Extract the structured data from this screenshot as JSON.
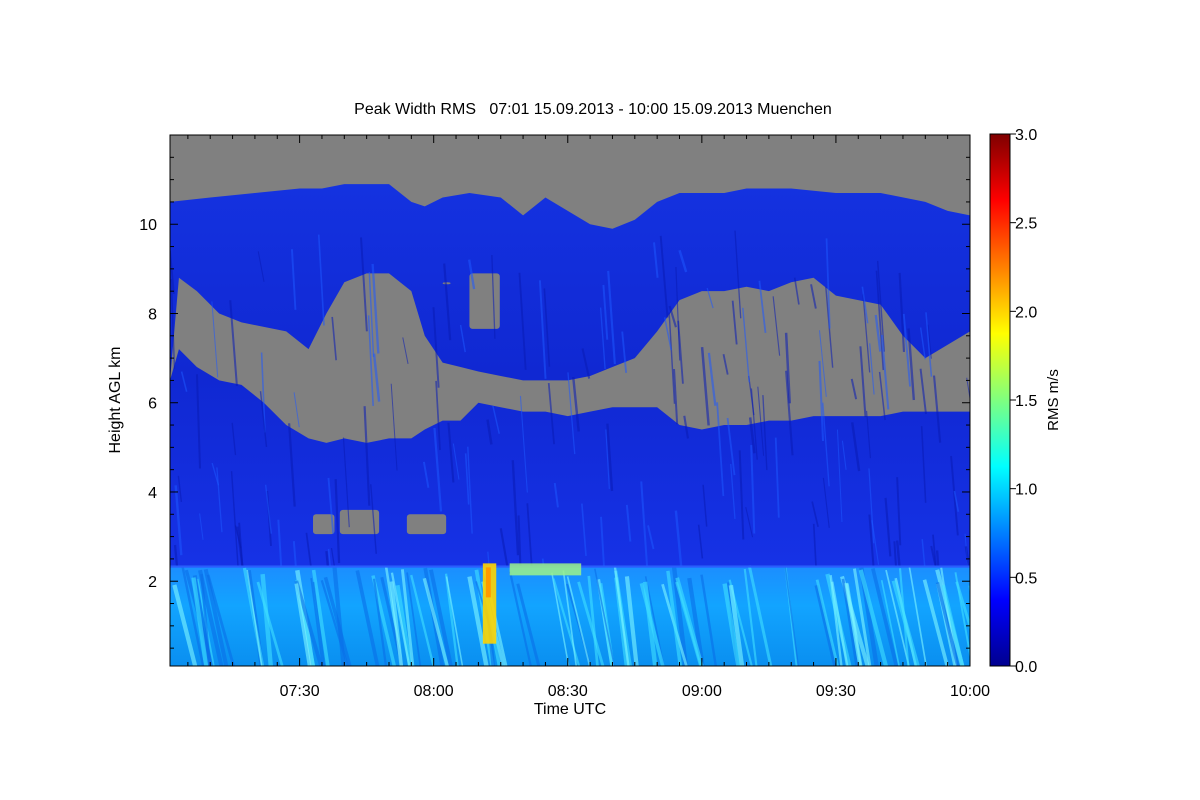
{
  "chart_data": {
    "type": "heatmap",
    "title": "Peak Width RMS   07:01 15.09.2013 - 10:00 15.09.2013 Muenchen",
    "xlabel": "Time UTC",
    "ylabel": "Height AGL km",
    "colorbar_label": "RMS m/s",
    "x_range_minutes": [
      421,
      600
    ],
    "y_range_km": [
      0.1,
      12.0
    ],
    "x_ticks": [
      {
        "min": 450,
        "label": "07:30"
      },
      {
        "min": 480,
        "label": "08:00"
      },
      {
        "min": 510,
        "label": "08:30"
      },
      {
        "min": 540,
        "label": "09:00"
      },
      {
        "min": 570,
        "label": "09:30"
      },
      {
        "min": 600,
        "label": "10:00"
      }
    ],
    "y_ticks": [
      {
        "v": 2,
        "label": "2"
      },
      {
        "v": 4,
        "label": "4"
      },
      {
        "v": 6,
        "label": "6"
      },
      {
        "v": 8,
        "label": "8"
      },
      {
        "v": 10,
        "label": "10"
      }
    ],
    "colorbar_range": [
      0.0,
      3.0
    ],
    "colorbar_ticks": [
      {
        "v": 0.0,
        "label": "0.0"
      },
      {
        "v": 0.5,
        "label": "0.5"
      },
      {
        "v": 1.0,
        "label": "1.0"
      },
      {
        "v": 1.5,
        "label": "1.5"
      },
      {
        "v": 2.0,
        "label": "2.0"
      },
      {
        "v": 2.5,
        "label": "2.5"
      },
      {
        "v": 3.0,
        "label": "3.0"
      }
    ],
    "colormap": "jet",
    "no_data_color": "#808080",
    "boundary_layer_top_km": 2.35,
    "cloud_top_km": [
      {
        "min": 421,
        "km": 10.5
      },
      {
        "min": 430,
        "km": 10.6
      },
      {
        "min": 440,
        "km": 10.7
      },
      {
        "min": 450,
        "km": 10.8
      },
      {
        "min": 455,
        "km": 10.8
      },
      {
        "min": 460,
        "km": 10.9
      },
      {
        "min": 470,
        "km": 10.9
      },
      {
        "min": 475,
        "km": 10.5
      },
      {
        "min": 478,
        "km": 10.4
      },
      {
        "min": 482,
        "km": 10.6
      },
      {
        "min": 488,
        "km": 10.7
      },
      {
        "min": 495,
        "km": 10.6
      },
      {
        "min": 500,
        "km": 10.2
      },
      {
        "min": 505,
        "km": 10.6
      },
      {
        "min": 510,
        "km": 10.3
      },
      {
        "min": 515,
        "km": 10.0
      },
      {
        "min": 520,
        "km": 9.9
      },
      {
        "min": 525,
        "km": 10.1
      },
      {
        "min": 530,
        "km": 10.5
      },
      {
        "min": 535,
        "km": 10.7
      },
      {
        "min": 540,
        "km": 10.7
      },
      {
        "min": 545,
        "km": 10.7
      },
      {
        "min": 550,
        "km": 10.8
      },
      {
        "min": 555,
        "km": 10.8
      },
      {
        "min": 560,
        "km": 10.8
      },
      {
        "min": 570,
        "km": 10.7
      },
      {
        "min": 580,
        "km": 10.7
      },
      {
        "min": 590,
        "km": 10.5
      },
      {
        "min": 595,
        "km": 10.3
      },
      {
        "min": 600,
        "km": 10.2
      }
    ],
    "clear_gap": [
      {
        "min": 421,
        "top": 6.5,
        "bot": 6.5
      },
      {
        "min": 423,
        "top": 8.8,
        "bot": 7.2
      },
      {
        "min": 427,
        "top": 8.5,
        "bot": 6.8
      },
      {
        "min": 432,
        "top": 8.0,
        "bot": 6.5
      },
      {
        "min": 437,
        "top": 7.8,
        "bot": 6.4
      },
      {
        "min": 442,
        "top": 7.7,
        "bot": 6.0
      },
      {
        "min": 447,
        "top": 7.6,
        "bot": 5.5
      },
      {
        "min": 452,
        "top": 7.2,
        "bot": 5.2
      },
      {
        "min": 456,
        "top": 8.0,
        "bot": 5.1
      },
      {
        "min": 460,
        "top": 8.7,
        "bot": 5.2
      },
      {
        "min": 465,
        "top": 8.9,
        "bot": 5.1
      },
      {
        "min": 470,
        "top": 8.9,
        "bot": 5.2
      },
      {
        "min": 475,
        "top": 8.5,
        "bot": 5.2
      },
      {
        "min": 478,
        "top": 7.5,
        "bot": 5.4
      },
      {
        "min": 482,
        "top": 6.9,
        "bot": 5.6
      },
      {
        "min": 486,
        "top": 6.8,
        "bot": 5.6
      },
      {
        "min": 490,
        "top": 6.7,
        "bot": 6.0
      },
      {
        "min": 495,
        "top": 6.6,
        "bot": 5.9
      },
      {
        "min": 500,
        "top": 6.5,
        "bot": 5.8
      },
      {
        "min": 505,
        "top": 6.5,
        "bot": 5.8
      },
      {
        "min": 510,
        "top": 6.5,
        "bot": 5.7
      },
      {
        "min": 515,
        "top": 6.6,
        "bot": 5.8
      },
      {
        "min": 520,
        "top": 6.8,
        "bot": 5.9
      },
      {
        "min": 525,
        "top": 7.0,
        "bot": 5.9
      },
      {
        "min": 530,
        "top": 7.6,
        "bot": 5.9
      },
      {
        "min": 535,
        "top": 8.3,
        "bot": 5.5
      },
      {
        "min": 540,
        "top": 8.5,
        "bot": 5.4
      },
      {
        "min": 545,
        "top": 8.5,
        "bot": 5.5
      },
      {
        "min": 550,
        "top": 8.6,
        "bot": 5.5
      },
      {
        "min": 555,
        "top": 8.5,
        "bot": 5.6
      },
      {
        "min": 560,
        "top": 8.7,
        "bot": 5.6
      },
      {
        "min": 565,
        "top": 8.8,
        "bot": 5.7
      },
      {
        "min": 570,
        "top": 8.4,
        "bot": 5.7
      },
      {
        "min": 575,
        "top": 8.3,
        "bot": 5.7
      },
      {
        "min": 580,
        "top": 8.2,
        "bot": 5.7
      },
      {
        "min": 585,
        "top": 7.5,
        "bot": 5.8
      },
      {
        "min": 590,
        "top": 7.0,
        "bot": 5.8
      },
      {
        "min": 595,
        "top": 7.3,
        "bot": 5.8
      },
      {
        "min": 600,
        "top": 7.6,
        "bot": 5.8
      }
    ],
    "isolated_gaps": [
      {
        "min_from": 440,
        "min_to": 442,
        "km_from": 6.3,
        "km_to": 7.4
      },
      {
        "min_from": 453,
        "min_to": 456,
        "km_from": 3.5,
        "km_to": 3.1
      },
      {
        "min_from": 459,
        "min_to": 466,
        "km_from": 3.6,
        "km_to": 3.1
      },
      {
        "min_from": 474,
        "min_to": 481,
        "km_from": 3.5,
        "km_to": 3.1
      },
      {
        "min_from": 482,
        "min_to": 482,
        "km_from": 8.7,
        "km_to": 8.7
      },
      {
        "min_from": 488,
        "min_to": 493,
        "km_from": 8.9,
        "km_to": 7.7
      }
    ],
    "max_rms_region": {
      "min_from": 491,
      "min_to": 494,
      "km_from": 0.6,
      "km_to": 2.4,
      "value": 2.0
    }
  }
}
